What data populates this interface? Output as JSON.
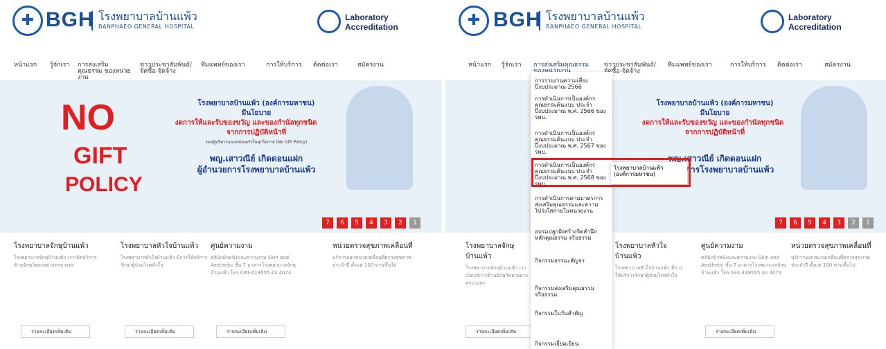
{
  "header": {
    "logo_text": "BGH",
    "hospital_name": "โรงพยาบาลบ้านแพ้ว",
    "hospital_sub": "BANPHAEO GENERAL HOSPITAL",
    "lab_title": "Laboratory Accreditation"
  },
  "nav": [
    "หน้าแรก",
    "รู้จักเรา",
    "การส่งเสริมคุณธรรม ของหน่วยงาน",
    "ข่าวประชาสัมพันธ์/ จัดซื้อ-จัดจ้าง",
    "ทีมแพทย์ของเรา",
    "การให้บริการ",
    "ติดต่อเรา",
    "สมัครงาน"
  ],
  "banner": {
    "no": "NO",
    "gift": "GIFT",
    "policy": "POLICY",
    "org": "โรงพยาบาลบ้านแพ้ว (องค์การมหาชน)",
    "policy_line": "มีนโยบาย",
    "line1": "งดการให้และรับของขวัญ และของกำนัลทุกชนิด",
    "line2": "จากการปฏิบัติหน้าที่",
    "small": "ของผู้บริหารและครอบครัวในทุกโอกาส (No Gift Policy)",
    "name": "พญ.เสาวณีย์ เกิดดอนแฝก",
    "role": "ผู้อำนวยการโรงพยาบาลบ้านแพ้ว"
  },
  "pagination": [
    "7",
    "6",
    "5",
    "4",
    "3",
    "2",
    "1"
  ],
  "columns": [
    {
      "title": "โรงพยาบาลจักษุบ้านแพ้ว",
      "body": "โรงพยาบาลจักษุบ้านแพ้ว เราเปิดบริการด้านจักษุวิทยาอย่างครบวงจร"
    },
    {
      "title": "โรงพยาบาลหัวใจบ้านแพ้ว",
      "body": "โรงพยาบาลหัวใจบ้านแพ้ว มีการให้บริการรักษาผู้ป่วยโรคหัวใจ"
    },
    {
      "title": "ศูนย์ความงาม",
      "body": "คลินิกผิวหนังและความงาม Skin and Aesthetic ชั้น 7 อาคารโรงพยาบาลจักษุบ้านแพ้ว โทร 034-419555 ต่อ 4074"
    },
    {
      "title": "หน่วยตรวจสุขภาพเคลื่อนที่",
      "body": "บริการออกหน่วยเคลื่อนที่ตรวจสุขภาพประจำปี ตั้งแต่ 100 ท่านขึ้นไป"
    }
  ],
  "more_label": "รายละเอียดเพิ่มเติม",
  "menu": [
    "การรายงานความเสี่ยง ปีงบประมาณ 2566",
    "การดำเนินการเป็นองค์กรคุณธรรมต้นแบบ ประจำปีงบประมาณ พ.ศ. 2566 ของ รพบ.",
    "การดำเนินการเป็นองค์กรคุณธรรมต้นแบบ ประจำปีงบประมาณ พ.ศ. 2567 ของ รพบ.",
    "การดำเนินการเป็นองค์กรคุณธรรมต้นแบบ ประจำปีงบประมาณ พ.ศ. 2568 ของ รพบ.",
    "การดำเนินการตามมาตรการส่งเสริมคุณธรรมและความโปร่งใสภายในหน่วยงาน",
    "อบรมปลูกฝังสร้างจิตสำนึกหลักคุณธรรม จริยธรรม",
    "กิจกรรมธรรมะสัญจร",
    "กิจกรรมส่งเสริมคุณธรรม จริยธรรม",
    "กิจกรรมในวันสำคัญ",
    "กิจกรรมเยี่ยมเยียน"
  ],
  "submenu": "โรงพยาบาลบ้านแพ้ว (องค์การมหาชน)"
}
